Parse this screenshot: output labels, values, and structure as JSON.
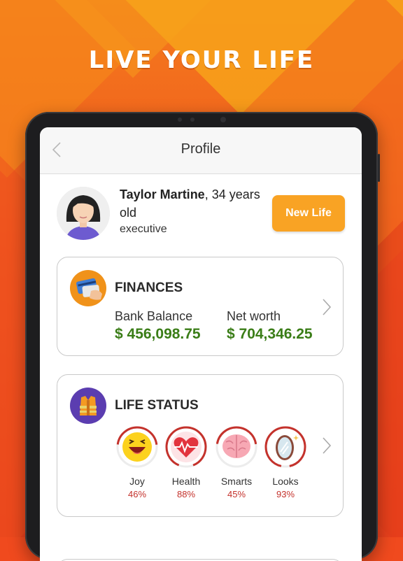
{
  "promo": {
    "headline": "LIVE YOUR LIFE"
  },
  "nav": {
    "title": "Profile"
  },
  "profile": {
    "name": "Taylor Martine",
    "age_text": ", 34 years old",
    "job": "executive",
    "new_life_label": "New Life"
  },
  "finances": {
    "title": "FINANCES",
    "bank_label": "Bank Balance",
    "bank_value": "$ 456,098.75",
    "networth_label": "Net worth",
    "networth_value": "$ 704,346.25"
  },
  "life_status": {
    "title": "LIFE STATUS",
    "stats": [
      {
        "label": "Joy",
        "percent": "46%",
        "value": 0.46,
        "icon": "happy-face-icon"
      },
      {
        "label": "Health",
        "percent": "88%",
        "value": 0.88,
        "icon": "heart-icon"
      },
      {
        "label": "Smarts",
        "percent": "45%",
        "value": 0.45,
        "icon": "brain-icon"
      },
      {
        "label": "Looks",
        "percent": "93%",
        "value": 0.93,
        "icon": "mirror-icon"
      }
    ]
  },
  "colors": {
    "accent": "#f9a324",
    "money": "#3a7d17",
    "stat_red": "#c4322c"
  }
}
